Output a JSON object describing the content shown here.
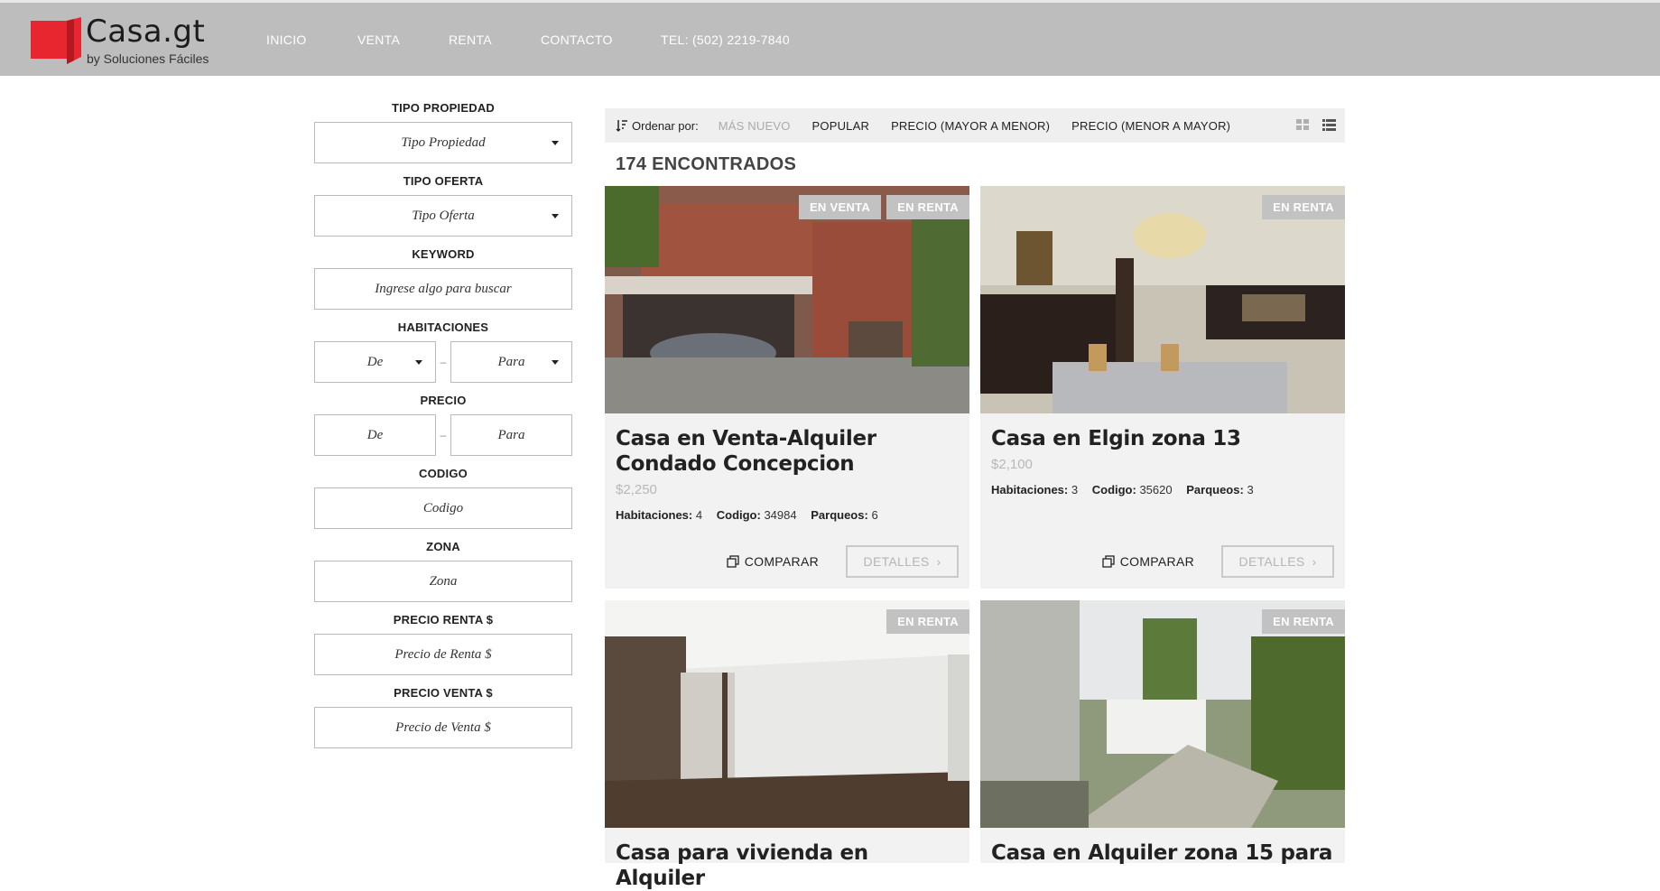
{
  "header": {
    "brand_title": "Casa.gt",
    "brand_subtitle": "by Soluciones Fáciles",
    "nav": [
      "INICIO",
      "VENTA",
      "RENTA",
      "CONTACTO",
      "TEL: (502) 2219-7840"
    ],
    "brand_color": "#e8262f"
  },
  "sidebar": {
    "tipo_propiedad": {
      "label": "TIPO PROPIEDAD",
      "value": "Tipo Propiedad"
    },
    "tipo_oferta": {
      "label": "TIPO OFERTA",
      "value": "Tipo Oferta"
    },
    "keyword": {
      "label": "KEYWORD",
      "placeholder": "Ingrese algo para buscar"
    },
    "habitaciones": {
      "label": "HABITACIONES",
      "from": "De",
      "to": "Para",
      "separator": "–"
    },
    "precio": {
      "label": "PRECIO",
      "from": "De",
      "to": "Para",
      "separator": "–"
    },
    "codigo": {
      "label": "CODIGO",
      "placeholder": "Codigo"
    },
    "zona": {
      "label": "ZONA",
      "placeholder": "Zona"
    },
    "precio_renta": {
      "label": "PRECIO RENTA $",
      "placeholder": "Precio de Renta $"
    },
    "precio_venta": {
      "label": "PRECIO VENTA $",
      "placeholder": "Precio de Venta $"
    }
  },
  "sortbar": {
    "label": "Ordenar por:",
    "options": [
      "MÁS NUEVO",
      "POPULAR",
      "PRECIO (MAYOR A MENOR)",
      "PRECIO (MENOR A MAYOR)"
    ],
    "active": "MÁS NUEVO"
  },
  "results": {
    "count_label": "174 ENCONTRADOS"
  },
  "labels": {
    "habitaciones": "Habitaciones:",
    "codigo": "Codigo:",
    "parqueos": "Parqueos:",
    "compare": "COMPARAR",
    "details": "DETALLES"
  },
  "cards": [
    {
      "badges": [
        "EN VENTA",
        "EN RENTA"
      ],
      "title": "Casa en Venta-Alquiler Condado Concepcion",
      "price": "$2,250",
      "habitaciones": "4",
      "codigo": "34984",
      "parqueos": "6"
    },
    {
      "badges": [
        "EN RENTA"
      ],
      "title": "Casa en Elgin zona 13",
      "price": "$2,100",
      "habitaciones": "3",
      "codigo": "35620",
      "parqueos": "3"
    },
    {
      "badges": [
        "EN RENTA"
      ],
      "title": "Casa para vivienda en Alquiler"
    },
    {
      "badges": [
        "EN RENTA"
      ],
      "title": "Casa en Alquiler zona 15 para"
    }
  ]
}
